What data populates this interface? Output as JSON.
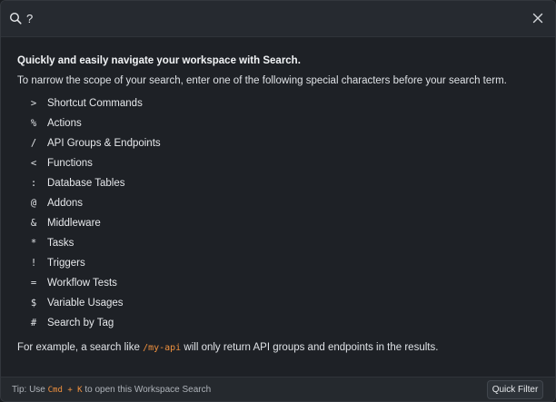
{
  "search": {
    "value": "?",
    "icon": "search-icon"
  },
  "help": {
    "heading": "Quickly and easily navigate your workspace with Search.",
    "intro": "To narrow the scope of your search, enter one of the following special characters before your search term.",
    "shortcuts": [
      {
        "char": ">",
        "label": "Shortcut Commands"
      },
      {
        "char": "%",
        "label": "Actions"
      },
      {
        "char": "/",
        "label": "API Groups & Endpoints"
      },
      {
        "char": "<",
        "label": "Functions"
      },
      {
        "char": ":",
        "label": "Database Tables"
      },
      {
        "char": "@",
        "label": "Addons"
      },
      {
        "char": "&",
        "label": "Middleware"
      },
      {
        "char": "*",
        "label": "Tasks"
      },
      {
        "char": "!",
        "label": "Triggers"
      },
      {
        "char": "=",
        "label": "Workflow Tests"
      },
      {
        "char": "$",
        "label": "Variable Usages"
      },
      {
        "char": "#",
        "label": "Search by Tag"
      }
    ],
    "example_prefix": "For example, a search like ",
    "example_code": "/my-api",
    "example_suffix": " will only return API groups and endpoints in the results."
  },
  "footer": {
    "tip_prefix": "Tip: Use ",
    "tip_key1": "Cmd",
    "tip_plus": " + ",
    "tip_key2": "K",
    "tip_suffix": " to open this Workspace Search",
    "quick_filter_label": "Quick Filter"
  },
  "colors": {
    "accent": "#f0913e",
    "background": "#1e2126"
  }
}
